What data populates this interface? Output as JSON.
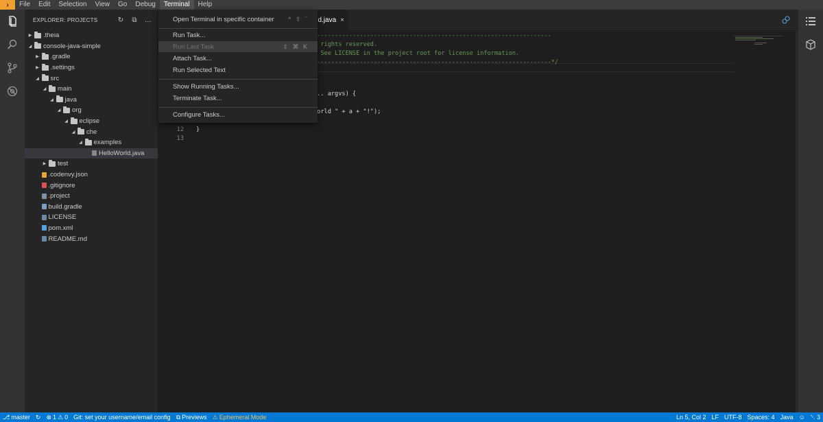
{
  "menubar": {
    "logo_glyph": "›",
    "items": [
      "File",
      "Edit",
      "Selection",
      "View",
      "Go",
      "Debug",
      "Terminal",
      "Help"
    ],
    "active": "Terminal"
  },
  "explorer": {
    "title": "EXPLORER: PROJECTS",
    "tree": [
      {
        "label": ".theia",
        "depth": 0,
        "type": "folder",
        "expanded": false
      },
      {
        "label": "console-java-simple",
        "depth": 0,
        "type": "folder",
        "expanded": true
      },
      {
        "label": ".gradle",
        "depth": 1,
        "type": "folder",
        "expanded": false
      },
      {
        "label": ".settings",
        "depth": 1,
        "type": "folder",
        "expanded": false
      },
      {
        "label": "src",
        "depth": 1,
        "type": "folder",
        "expanded": true
      },
      {
        "label": "main",
        "depth": 2,
        "type": "folder",
        "expanded": true
      },
      {
        "label": "java",
        "depth": 3,
        "type": "folder",
        "expanded": true
      },
      {
        "label": "org",
        "depth": 4,
        "type": "folder",
        "expanded": true
      },
      {
        "label": "eclipse",
        "depth": 5,
        "type": "folder",
        "expanded": true
      },
      {
        "label": "che",
        "depth": 6,
        "type": "folder",
        "expanded": true
      },
      {
        "label": "examples",
        "depth": 7,
        "type": "folder",
        "expanded": true
      },
      {
        "label": "HelloWorld.java",
        "depth": 8,
        "type": "java",
        "selected": true
      },
      {
        "label": "test",
        "depth": 2,
        "type": "folder",
        "expanded": false
      },
      {
        "label": ".codenvy.json",
        "depth": 1,
        "type": "json"
      },
      {
        "label": ".gitignore",
        "depth": 1,
        "type": "git"
      },
      {
        "label": ".project",
        "depth": 1,
        "type": "project"
      },
      {
        "label": "build.gradle",
        "depth": 1,
        "type": "gradle"
      },
      {
        "label": "LICENSE",
        "depth": 1,
        "type": "text"
      },
      {
        "label": "pom.xml",
        "depth": 1,
        "type": "xml"
      },
      {
        "label": "README.md",
        "depth": 1,
        "type": "text"
      }
    ]
  },
  "editor": {
    "tab_label": "d.java",
    "tab_close": "×",
    "code_lines": [
      {
        "num": "",
        "text": "-------------------------------------------------------------------",
        "cls": "comment",
        "offset": 171
      },
      {
        "num": "",
        "text": "l rights reserved.",
        "cls": "comment",
        "offset": 171
      },
      {
        "num": "",
        "text": ", See LICENSE in the project root for license information.",
        "cls": "comment",
        "offset": 171
      },
      {
        "num": "",
        "text": "-------------------------------------------------------------------*/",
        "cls": "comment",
        "offset": 171
      },
      {
        "num": "",
        "text": "",
        "cls": "plain",
        "offset": 171
      },
      {
        "num": "",
        "text": "",
        "cls": "plain",
        "offset": 171
      },
      {
        "num": "",
        "text": "... argvs) {",
        "cls": "plain",
        "offset": 171
      },
      {
        "num": "",
        "text": "",
        "cls": "plain",
        "offset": 171
      },
      {
        "num": "",
        "text": "World \" + a + \"!\");",
        "cls": "mixed",
        "offset": 171
      },
      {
        "num": "",
        "text": "",
        "cls": "plain",
        "offset": 171
      },
      {
        "num": "12",
        "text": "}",
        "cls": "plain",
        "offset": 0
      },
      {
        "num": "13",
        "text": "",
        "cls": "plain",
        "offset": 0
      }
    ]
  },
  "terminal_menu": {
    "items": [
      {
        "label": "Open Terminal in specific container",
        "shortcut": "^ ⇧ `",
        "disabled": false
      },
      {
        "label": "Run Task...",
        "shortcut": "",
        "disabled": false
      },
      {
        "label": "Run Last Task",
        "shortcut": "⇧ ⌘ K",
        "disabled": true
      },
      {
        "label": "Attach Task...",
        "shortcut": "",
        "disabled": false
      },
      {
        "label": "Run Selected Text",
        "shortcut": "",
        "disabled": false
      },
      {
        "label": "Show Running Tasks...",
        "shortcut": "",
        "disabled": false
      },
      {
        "label": "Terminate Task...",
        "shortcut": "",
        "disabled": false
      },
      {
        "label": "Configure Tasks...",
        "shortcut": "",
        "disabled": false
      }
    ]
  },
  "statusbar": {
    "branch": "master",
    "errors": "1",
    "warnings": "0",
    "git_message": "Git: set your username/email config",
    "previews": "Previews",
    "ephemeral": "Ephemeral Mode",
    "position": "Ln 5, Col 2",
    "eol": "LF",
    "encoding": "UTF-8",
    "spaces": "Spaces: 4",
    "language": "Java",
    "notifications": "3"
  },
  "colors": {
    "accent": "#0078d4",
    "logo": "#f0a030",
    "comment": "#6a9955",
    "string": "#ce9178"
  }
}
